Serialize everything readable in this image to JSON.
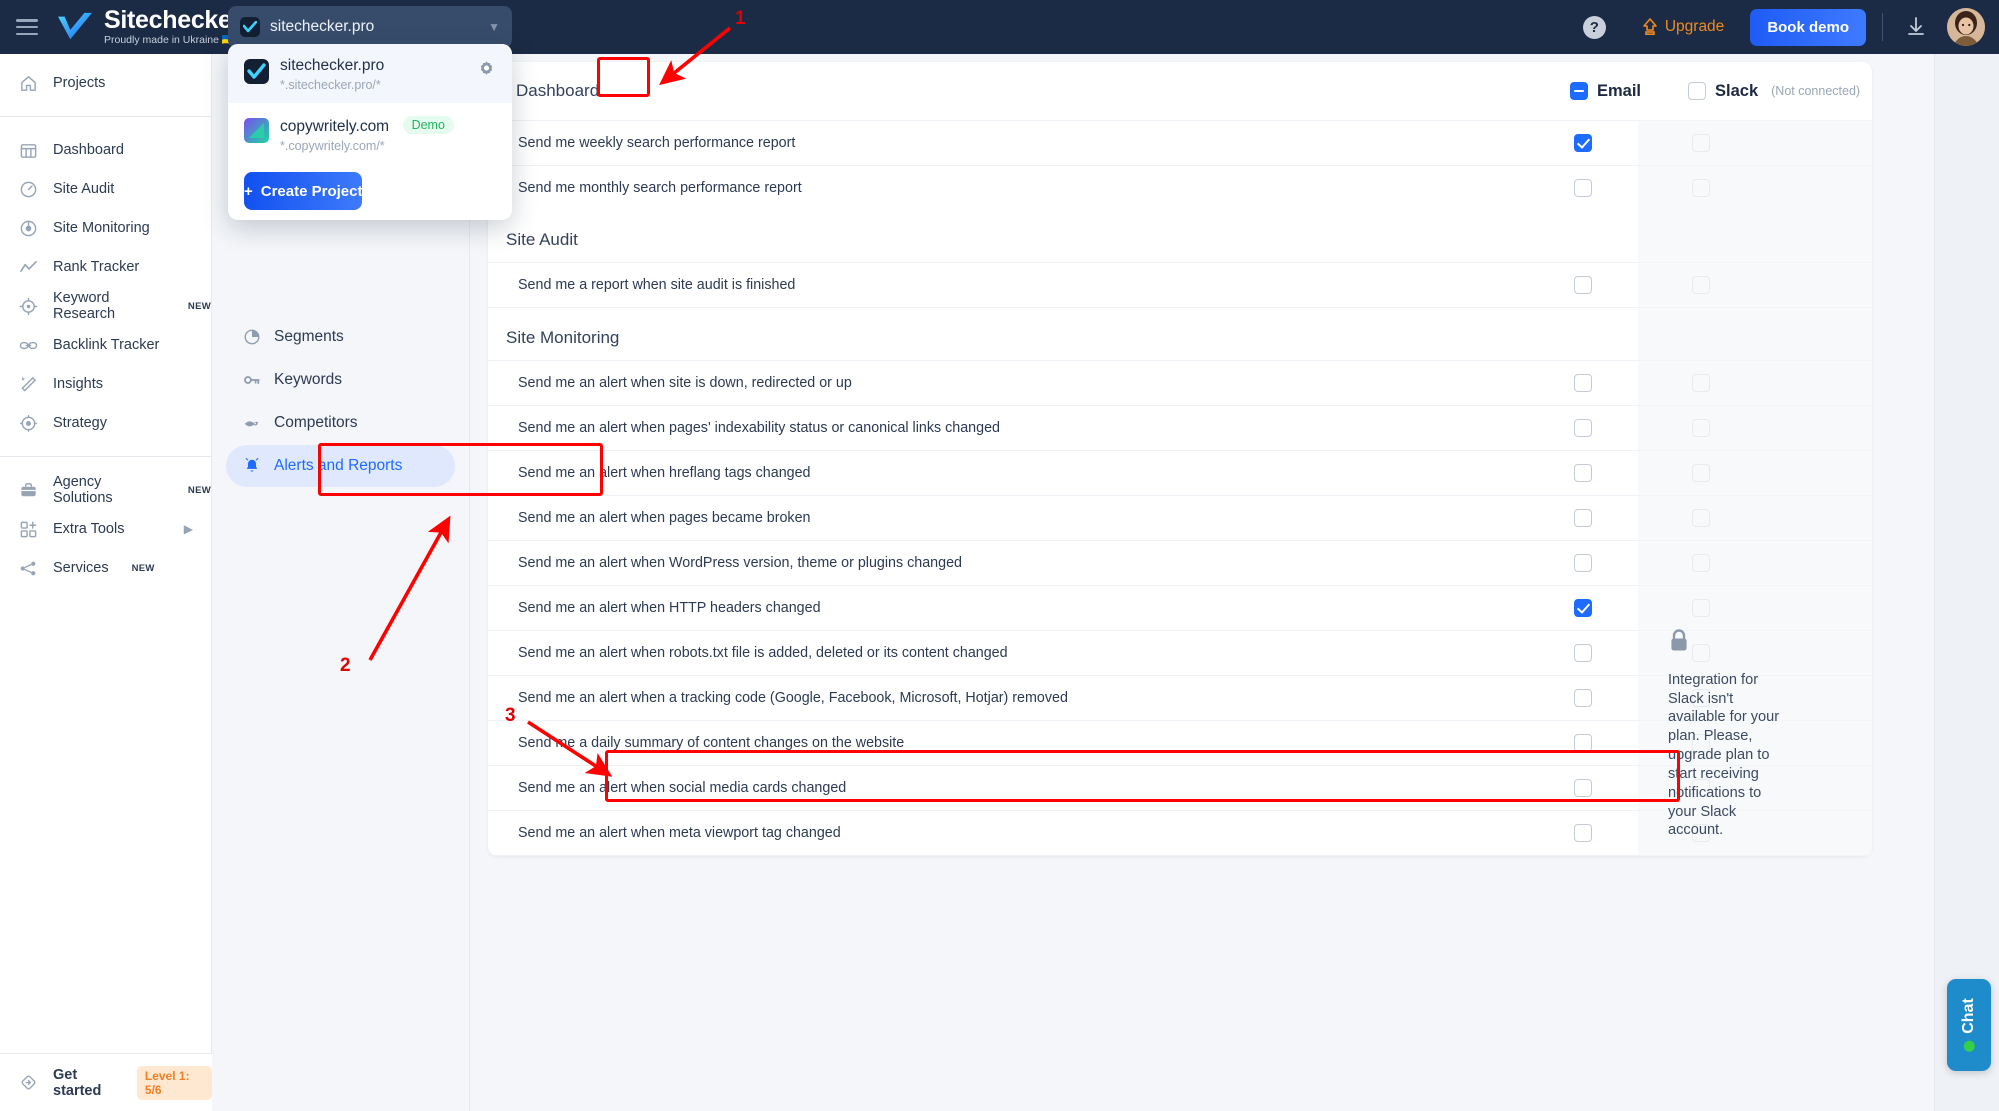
{
  "topbar": {
    "brand_name": "Sitechecker",
    "brand_tagline": "Proudly made in Ukraine 🇺🇦",
    "menu_icon": "hamburger-icon",
    "project_selected": "sitechecker.pro",
    "help_label": "?",
    "upgrade_label": "Upgrade",
    "book_demo_label": "Book demo",
    "download_icon": "download-icon",
    "avatar": "user-avatar"
  },
  "project_dropdown": {
    "items": [
      {
        "name": "sitechecker.pro",
        "url": "*.sitechecker.pro/*",
        "badge": "",
        "selected": true
      },
      {
        "name": "copywritely.com",
        "url": "*.copywritely.com/*",
        "badge": "Demo",
        "selected": false
      }
    ],
    "create_button": "Create Project",
    "create_plus": "+",
    "gear_icon": "gear-icon"
  },
  "sidebar": {
    "top": [
      {
        "label": "Projects",
        "icon": "home-icon",
        "badge": ""
      }
    ],
    "main": [
      {
        "label": "Dashboard",
        "icon": "dashboard-icon",
        "badge": ""
      },
      {
        "label": "Site Audit",
        "icon": "gauge-icon",
        "badge": ""
      },
      {
        "label": "Site Monitoring",
        "icon": "radar-icon",
        "badge": ""
      },
      {
        "label": "Rank Tracker",
        "icon": "chart-line-icon",
        "badge": ""
      },
      {
        "label": "Keyword Research",
        "icon": "target-icon",
        "badge": "NEW"
      },
      {
        "label": "Backlink Tracker",
        "icon": "link-icon",
        "badge": ""
      },
      {
        "label": "Insights",
        "icon": "magic-wand-icon",
        "badge": ""
      },
      {
        "label": "Strategy",
        "icon": "bullseye-icon",
        "badge": ""
      }
    ],
    "bottom": [
      {
        "label": "Agency Solutions",
        "icon": "briefcase-icon",
        "badge": "NEW",
        "chevron": false
      },
      {
        "label": "Extra Tools",
        "icon": "grid-plus-icon",
        "badge": "",
        "chevron": true
      },
      {
        "label": "Services",
        "icon": "nodes-icon",
        "badge": "NEW",
        "chevron": false
      }
    ],
    "get_started": {
      "label": "Get started",
      "icon": "rocket-diamond-icon",
      "level": "Level 1: 5/6"
    }
  },
  "subnav": {
    "items": [
      {
        "label": "Segments",
        "icon": "pie-chart-icon",
        "active": false
      },
      {
        "label": "Keywords",
        "icon": "key-icon",
        "active": false
      },
      {
        "label": "Competitors",
        "icon": "fish-icon",
        "active": false
      },
      {
        "label": "Alerts and Reports",
        "icon": "bell-icon",
        "active": true
      }
    ]
  },
  "main": {
    "header": {
      "title": "Dashboard",
      "email_label": "Email",
      "slack_label": "Slack",
      "slack_note": "(Not connected)",
      "email_state": "indeterminate",
      "slack_state": "off"
    },
    "sections": [
      {
        "title": "Dashboard",
        "is_header_row": true,
        "rows": [
          {
            "label": "Send me weekly search performance report",
            "email": true,
            "slack": false
          },
          {
            "label": "Send me monthly search performance report",
            "email": false,
            "slack": false
          }
        ]
      },
      {
        "title": "Site Audit",
        "is_header_row": false,
        "rows": [
          {
            "label": "Send me a report when site audit is finished",
            "email": false,
            "slack": false
          }
        ]
      },
      {
        "title": "Site Monitoring",
        "is_header_row": false,
        "rows": [
          {
            "label": "Send me an alert when site is down, redirected or up",
            "email": false,
            "slack": false
          },
          {
            "label": "Send me an alert when pages' indexability status or canonical links changed",
            "email": false,
            "slack": false
          },
          {
            "label": "Send me an alert when hreflang tags changed",
            "email": false,
            "slack": false
          },
          {
            "label": "Send me an alert when pages became broken",
            "email": false,
            "slack": false
          },
          {
            "label": "Send me an alert when WordPress version, theme or plugins changed",
            "email": false,
            "slack": false
          },
          {
            "label": "Send me an alert when HTTP headers changed",
            "email": true,
            "slack": false,
            "highlighted": true
          },
          {
            "label": "Send me an alert when robots.txt file is added, deleted or its content changed",
            "email": false,
            "slack": false
          },
          {
            "label": "Send me an alert when a tracking code (Google, Facebook, Microsoft, Hotjar) removed",
            "email": false,
            "slack": false
          },
          {
            "label": "Send me a daily summary of content changes on the website",
            "email": false,
            "slack": false
          },
          {
            "label": "Send me an alert when social media cards changed",
            "email": false,
            "slack": false
          },
          {
            "label": "Send me an alert when meta viewport tag changed",
            "email": false,
            "slack": false
          }
        ]
      }
    ],
    "slack_lock": {
      "icon": "lock-icon",
      "text": "Integration for Slack isn't available for your plan. Please, upgrade plan to start receiving notifications to your Slack account."
    }
  },
  "chat_widget": {
    "label": "Chat",
    "status": "online"
  },
  "annotations": {
    "accent_color": "#ff0000",
    "steps": [
      {
        "number": "1",
        "target": "gear-icon"
      },
      {
        "number": "2",
        "target": "alerts-and-reports-nav"
      },
      {
        "number": "3",
        "target": "http-headers-row"
      }
    ]
  }
}
